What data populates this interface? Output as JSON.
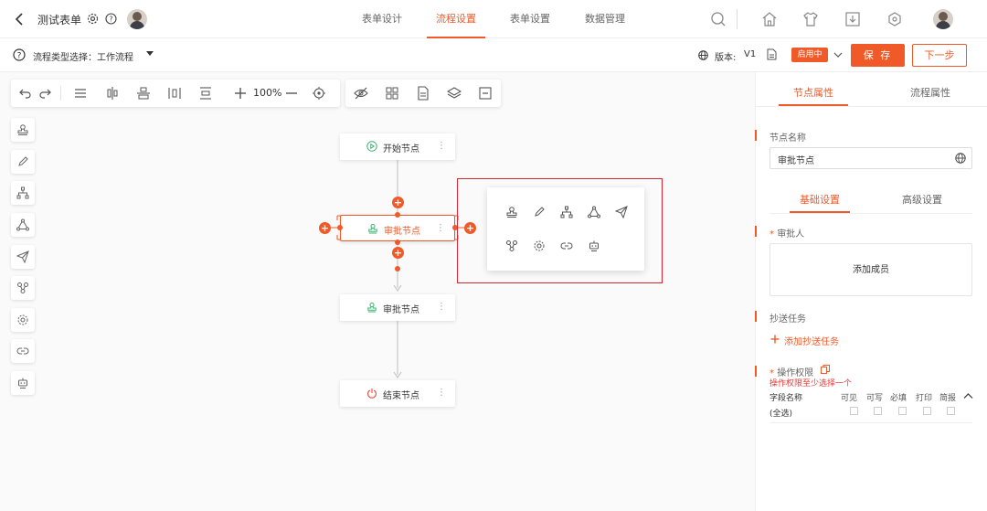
{
  "header": {
    "back_icon": "chevron-left-icon",
    "app_title": "测试表单",
    "tabs": [
      {
        "label": "表单设计",
        "active": false
      },
      {
        "label": "流程设置",
        "active": true
      },
      {
        "label": "表单设置",
        "active": false
      },
      {
        "label": "数据管理",
        "active": false
      }
    ],
    "icons": [
      "search-icon",
      "home-icon",
      "shirt-icon",
      "download-icon",
      "hexagon-settings-icon"
    ]
  },
  "subbar": {
    "flow_type_label": "流程类型选择：工作流程",
    "version_label": "版本:",
    "version_value": "V1",
    "status": "启用中",
    "save_label": "保 存",
    "next_label": "下一步"
  },
  "toolbar": {
    "zoom": "100%"
  },
  "nodes": {
    "start": "开始节点",
    "approve1": "审批节点",
    "approve2": "审批节点",
    "end": "结束节点"
  },
  "panel": {
    "tabs": [
      "节点属性",
      "流程属性"
    ],
    "node_name_label": "节点名称",
    "node_name_value": "审批节点",
    "subtabs": [
      "基础设置",
      "高级设置"
    ],
    "approver_label": "审批人",
    "add_member": "添加成员",
    "cc_label": "抄送任务",
    "add_cc": "添加抄送任务",
    "perm_label": "操作权限",
    "perm_error": "操作权限至少选择一个",
    "field_col": "字段名称",
    "columns": [
      "可见",
      "可写",
      "必填",
      "打印",
      "简报"
    ],
    "row_label": "(全选)"
  },
  "colors": {
    "accent": "#f05a28",
    "highlight_box": "#d9262c"
  }
}
